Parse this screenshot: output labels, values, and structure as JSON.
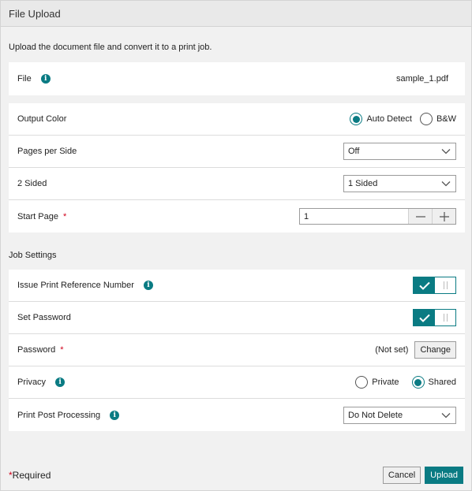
{
  "dialog": {
    "title": "File Upload",
    "description": "Upload the document file and convert it to a print job."
  },
  "file": {
    "label": "File",
    "value": "sample_1.pdf"
  },
  "output_color": {
    "label": "Output Color",
    "options": [
      "Auto Detect",
      "B&W"
    ],
    "selected": "Auto Detect"
  },
  "pages_per_side": {
    "label": "Pages per Side",
    "value": "Off"
  },
  "two_sided": {
    "label": "2 Sided",
    "value": "1 Sided"
  },
  "start_page": {
    "label": "Start Page",
    "required_mark": "*",
    "value": "1"
  },
  "job_settings": {
    "heading": "Job Settings",
    "issue_ref": {
      "label": "Issue Print Reference Number",
      "enabled": true
    },
    "set_password": {
      "label": "Set Password",
      "enabled": true
    },
    "password": {
      "label": "Password",
      "required_mark": "*",
      "status": "(Not set)",
      "button": "Change"
    },
    "privacy": {
      "label": "Privacy",
      "options": [
        "Private",
        "Shared"
      ],
      "selected": "Shared"
    },
    "post_processing": {
      "label": "Print Post Processing",
      "value": "Do Not Delete"
    }
  },
  "footer": {
    "required_star": "*",
    "required_text": "Required",
    "cancel": "Cancel",
    "upload": "Upload"
  },
  "colors": {
    "accent": "#0a7b83",
    "required": "#d0021b"
  }
}
